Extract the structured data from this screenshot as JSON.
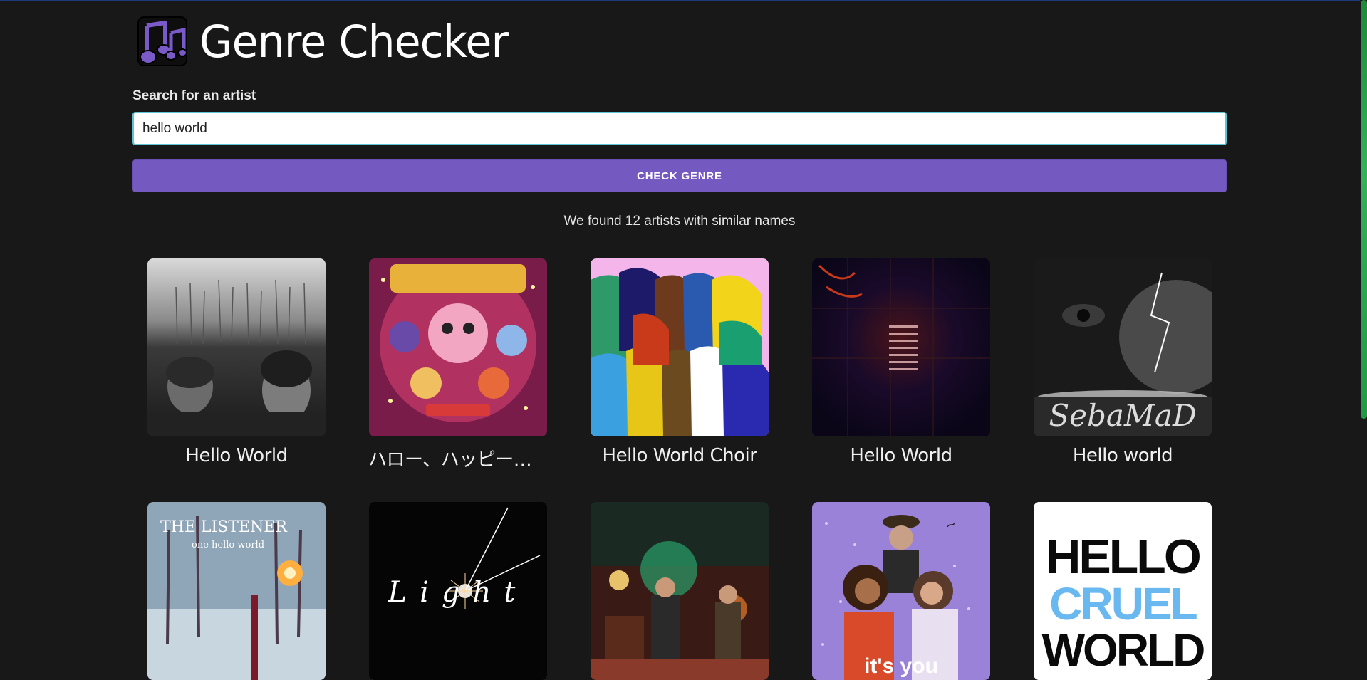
{
  "app": {
    "title": "Genre Checker",
    "logo_icon": "music-notes-icon"
  },
  "search": {
    "label": "Search for an artist",
    "value": "hello world",
    "placeholder": ""
  },
  "button": {
    "label": "CHECK GENRE"
  },
  "results": {
    "summary": "We found 12 artists with similar names",
    "artists": [
      {
        "name": "Hello World"
      },
      {
        "name": "ハロー、ハッピーワ…"
      },
      {
        "name": "Hello World Choir"
      },
      {
        "name": "Hello World"
      },
      {
        "name": "Hello world"
      },
      {
        "name": "",
        "cover_text": "THE LISTENER",
        "cover_subtext": "one hello world"
      },
      {
        "name": "",
        "cover_text": "Light"
      },
      {
        "name": ""
      },
      {
        "name": "",
        "cover_text": "it's you"
      },
      {
        "name": "",
        "cover_text": "HELLO CRUEL WORLD"
      }
    ],
    "cover_labels": {
      "sebamad": "SebaMaD"
    }
  },
  "colors": {
    "background": "#181818",
    "accent": "#7459c0",
    "input_border": "#5fc4d4",
    "scrollbar": "#2fb35b"
  }
}
